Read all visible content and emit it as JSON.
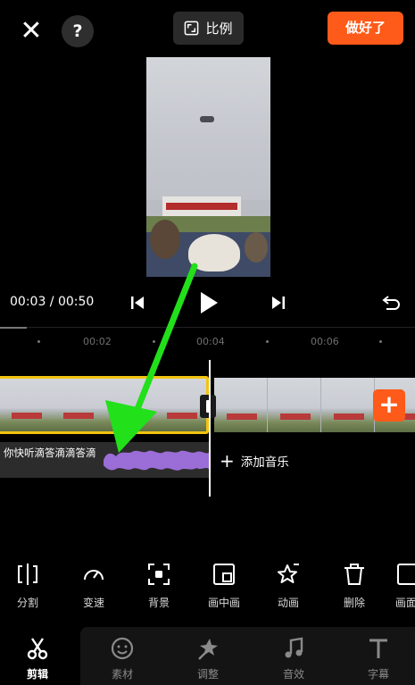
{
  "topbar": {
    "close_icon": "✕",
    "help_icon": "?",
    "ratio_label": "比例",
    "done_label": "做好了"
  },
  "playback": {
    "current_time": "00:03",
    "total_time": "00:50",
    "time_display": "00:03 / 00:50"
  },
  "preview": {
    "sign_text": "BAE SYSTEMS"
  },
  "ruler": {
    "ticks": [
      "00:02",
      "00:04",
      "00:06"
    ]
  },
  "timeline": {
    "audio_label": "你快听滴答滴滴答滴",
    "add_music_label": "添加音乐",
    "add_clip_icon": "+"
  },
  "tools": [
    {
      "label": "分割",
      "icon": "split-icon"
    },
    {
      "label": "变速",
      "icon": "speed-icon"
    },
    {
      "label": "背景",
      "icon": "background-icon"
    },
    {
      "label": "画中画",
      "icon": "pip-icon"
    },
    {
      "label": "动画",
      "icon": "animation-icon"
    },
    {
      "label": "删除",
      "icon": "delete-icon"
    },
    {
      "label": "画面",
      "icon": "frame-icon"
    }
  ],
  "nav": [
    {
      "label": "剪辑",
      "icon": "scissors-icon",
      "active": true
    },
    {
      "label": "素材",
      "icon": "sticker-icon"
    },
    {
      "label": "调整",
      "icon": "adjust-icon"
    },
    {
      "label": "音效",
      "icon": "music-icon"
    },
    {
      "label": "字幕",
      "icon": "text-icon"
    }
  ],
  "colors": {
    "accent": "#fe5a19",
    "selection": "#f1c40f",
    "waveform": "#9b6dd6",
    "annotation_arrow": "#22e01a"
  }
}
